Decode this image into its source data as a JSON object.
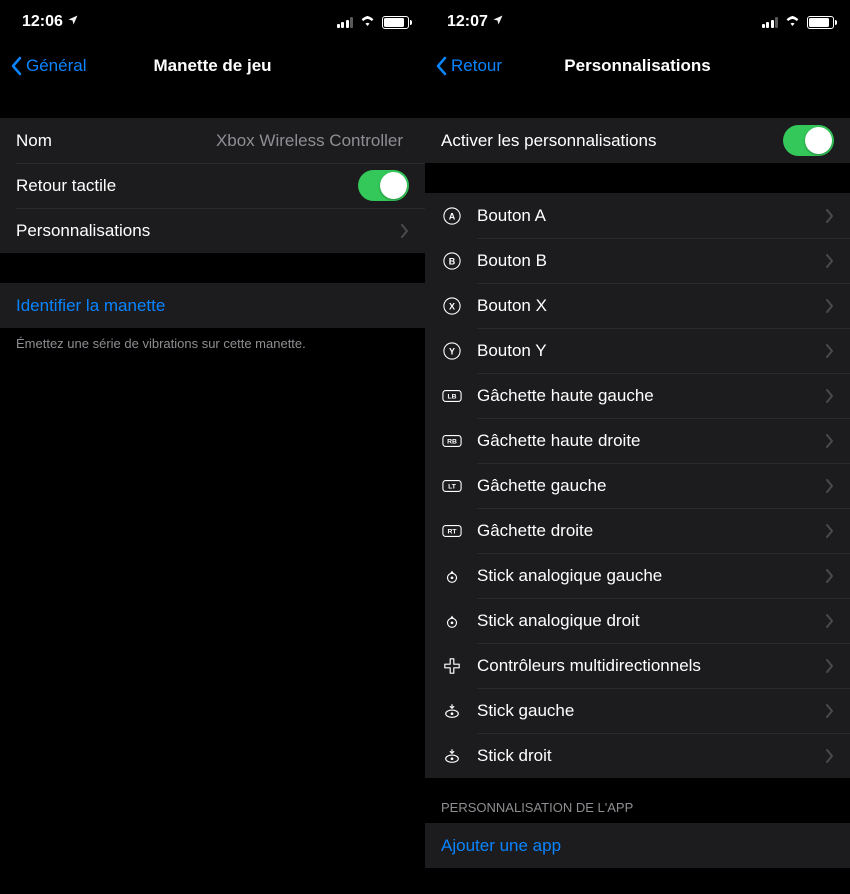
{
  "left": {
    "status": {
      "time": "12:06"
    },
    "nav": {
      "back": "Général",
      "title": "Manette de jeu"
    },
    "rows": {
      "name_label": "Nom",
      "name_value": "Xbox Wireless Controller",
      "haptic_label": "Retour tactile",
      "custom_label": "Personnalisations",
      "identify_label": "Identifier la manette"
    },
    "footer": "Émettez une série de vibrations sur cette manette."
  },
  "right": {
    "status": {
      "time": "12:07"
    },
    "nav": {
      "back": "Retour",
      "title": "Personnalisations"
    },
    "enable_label": "Activer les personnalisations",
    "buttons": [
      {
        "glyph": "A",
        "label": "Bouton A"
      },
      {
        "glyph": "B",
        "label": "Bouton B"
      },
      {
        "glyph": "X",
        "label": "Bouton X"
      },
      {
        "glyph": "Y",
        "label": "Bouton Y"
      },
      {
        "glyph": "LB",
        "label": "Gâchette haute gauche"
      },
      {
        "glyph": "RB",
        "label": "Gâchette haute droite"
      },
      {
        "glyph": "LT",
        "label": "Gâchette gauche"
      },
      {
        "glyph": "RT",
        "label": "Gâchette droite"
      },
      {
        "glyph": "stick",
        "label": "Stick analogique gauche"
      },
      {
        "glyph": "stick",
        "label": "Stick analogique droit"
      },
      {
        "glyph": "dpad",
        "label": "Contrôleurs multidirectionnels"
      },
      {
        "glyph": "press",
        "label": "Stick gauche"
      },
      {
        "glyph": "press",
        "label": "Stick droit"
      }
    ],
    "section_header": "PERSONNALISATION DE L'APP",
    "add_app_label": "Ajouter une app"
  }
}
